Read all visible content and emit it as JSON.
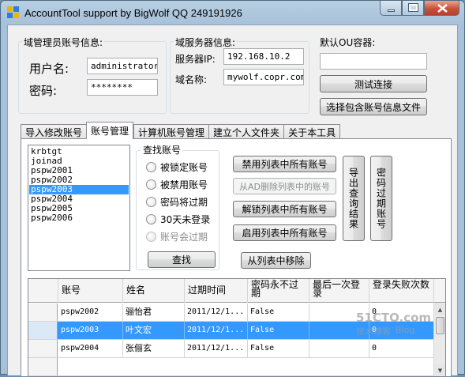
{
  "window": {
    "title": "AccountTool support by BigWolf QQ 249191926"
  },
  "domain_admin": {
    "group_label": "域管理员账号信息:",
    "username_label": "用户名:",
    "username_value": "administrator",
    "password_label": "密码:",
    "password_value": "********"
  },
  "domain_server": {
    "group_label": "域服务器信息:",
    "ip_label": "服务器IP:",
    "ip_value": "192.168.10.2",
    "domain_label": "域名称:",
    "domain_value": "mywolf.copr.com"
  },
  "default_ou": {
    "label": "默认OU容器:",
    "value": "",
    "test_button": "测试连接",
    "select_file_button": "选择包含账号信息文件"
  },
  "tabs": [
    {
      "label": "导入修改账号"
    },
    {
      "label": "账号管理"
    },
    {
      "label": "计算机账号管理"
    },
    {
      "label": "建立个人文件夹"
    },
    {
      "label": "关于本工具"
    }
  ],
  "account_list": [
    "krbtgt",
    "joinad",
    "pspw2001",
    "pspw2002",
    "pspw2003",
    "pspw2004",
    "pspw2005",
    "pspw2006"
  ],
  "selected_account": "pspw2003",
  "search": {
    "group_label": "查找账号",
    "options": [
      {
        "label": "被锁定账号"
      },
      {
        "label": "被禁用账号"
      },
      {
        "label": "密码将过期"
      },
      {
        "label": "30天未登录"
      },
      {
        "label": "账号会过期"
      }
    ],
    "find_button": "查找"
  },
  "actions": {
    "disable_all": "禁用列表中所有账号",
    "delete_from_ad": "从AD删除列表中的账号",
    "unlock_all": "解锁列表中所有账号",
    "enable_all": "启用列表中所有账号",
    "remove_from_list": "从列表中移除",
    "export_results": "导出查询结果",
    "password_expire": "密码过期账号"
  },
  "grid": {
    "columns": [
      {
        "label": "账号"
      },
      {
        "label": "姓名"
      },
      {
        "label": "过期时间"
      },
      {
        "label": "密码永不过期"
      },
      {
        "label": "最后一次登录"
      },
      {
        "label": "登录失败次数"
      }
    ],
    "rows": [
      {
        "account": "pspw2002",
        "name": "骊怡君",
        "expires": "2011/12/1...",
        "never_expires": "False",
        "last_login": "",
        "failures": "0"
      },
      {
        "account": "pspw2003",
        "name": "叶文宏",
        "expires": "2011/12/1...",
        "never_expires": "False",
        "last_login": "",
        "failures": "0"
      },
      {
        "account": "pspw2004",
        "name": "张俪玄",
        "expires": "2011/12/1...",
        "never_expires": "False",
        "last_login": "",
        "failures": "0"
      }
    ]
  },
  "watermark": {
    "line1": "51CTO.com",
    "line2": "技术博客",
    "line3": "Blog"
  },
  "colors": {
    "selection": "#3399ff",
    "window_frame": "#a7c1d9",
    "close_button": "#c8523a"
  }
}
